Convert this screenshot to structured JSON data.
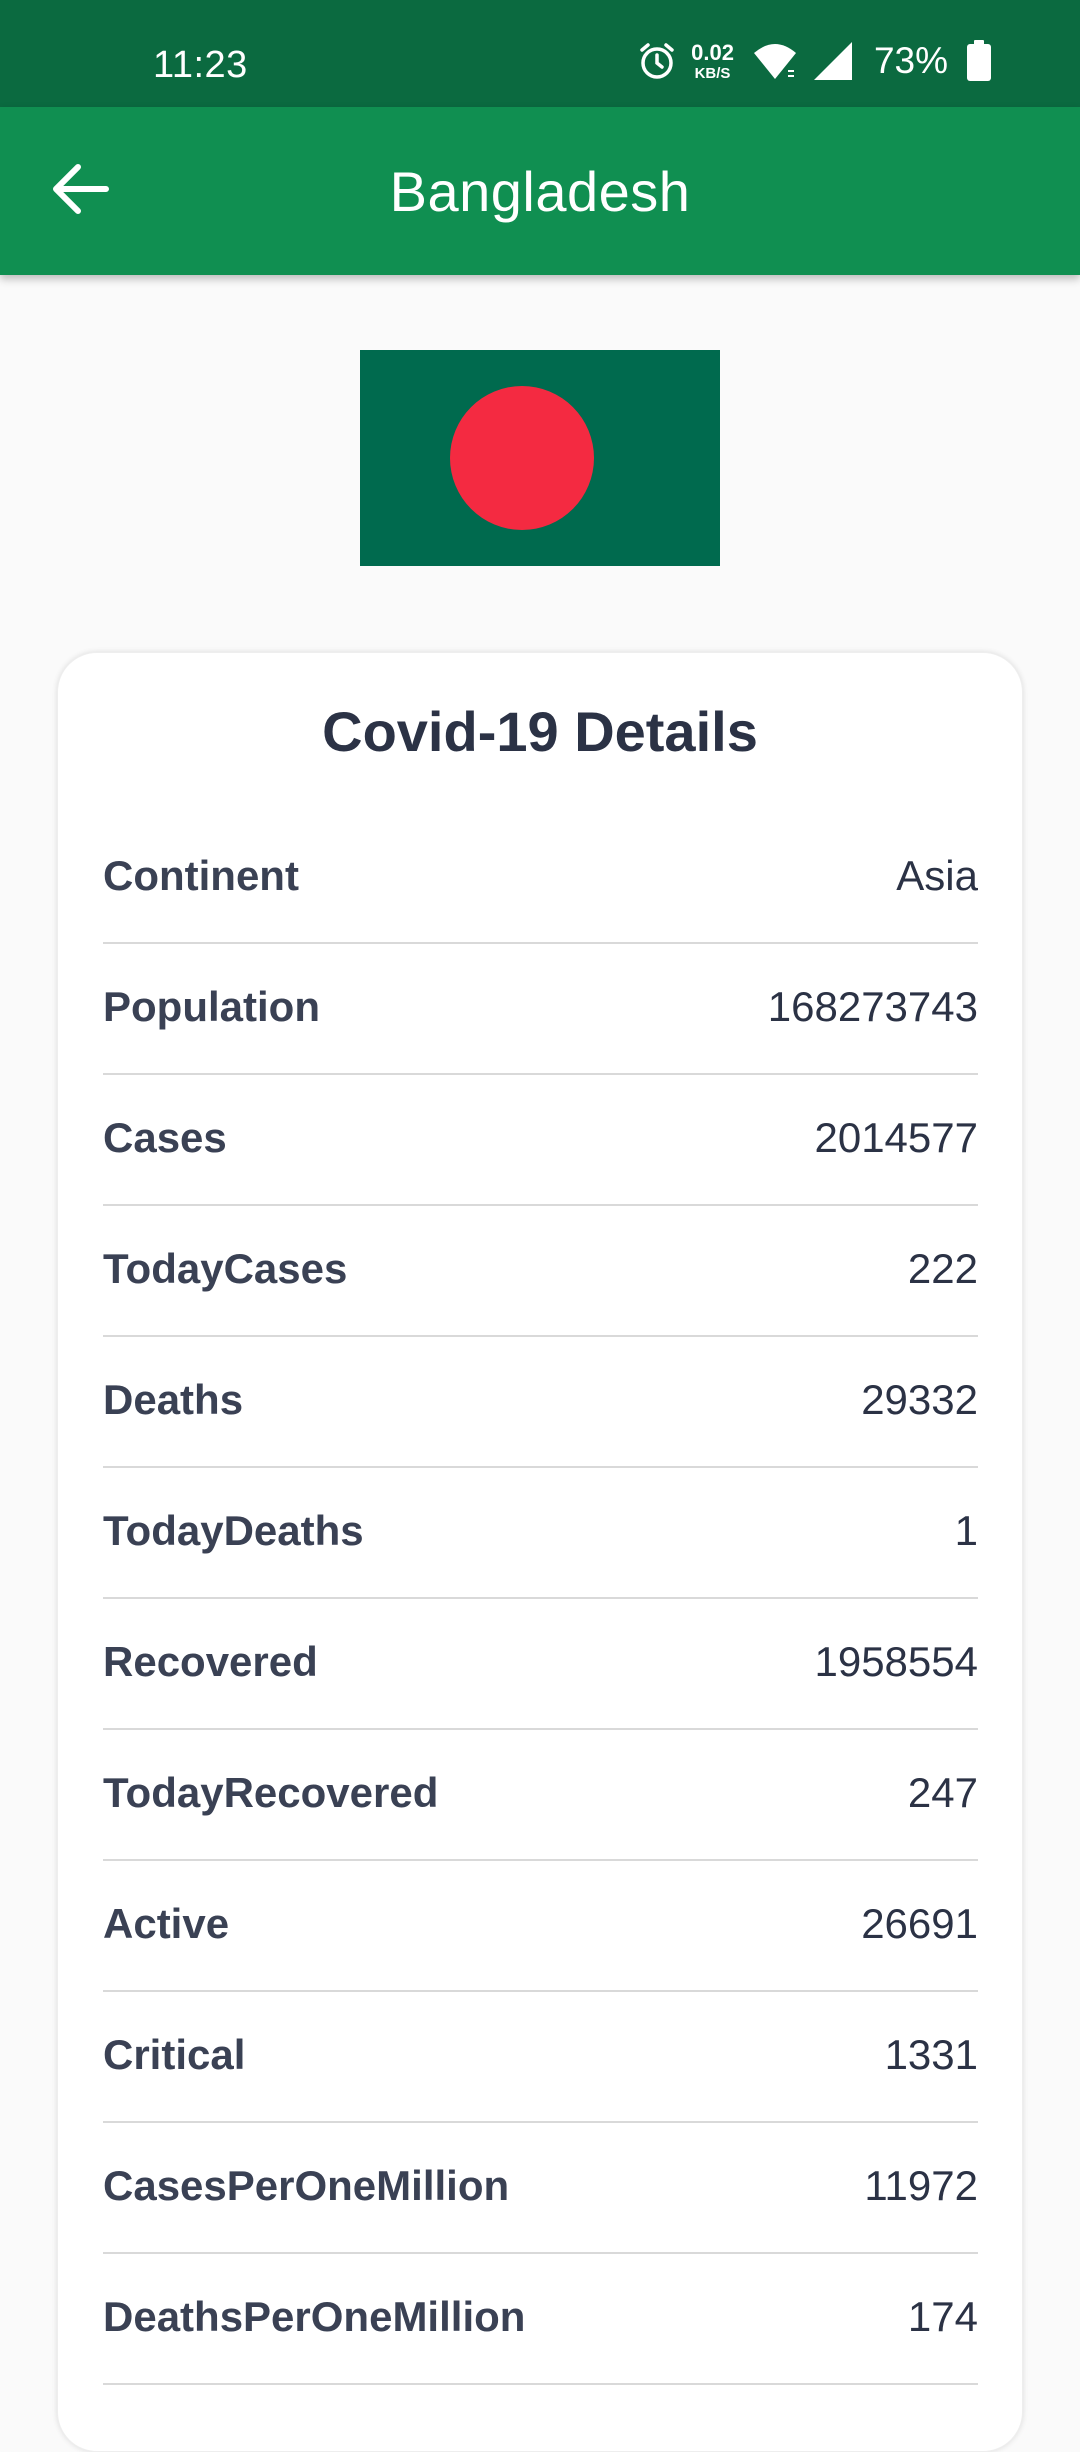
{
  "status_bar": {
    "time": "11:23",
    "net_speed_value": "0.02",
    "net_speed_unit": "KB/S",
    "battery_percent": "73%",
    "icons": [
      "alarm-icon",
      "wifi-icon",
      "cellular-signal-icon",
      "battery-icon"
    ]
  },
  "app_bar": {
    "title": "Bangladesh",
    "back_icon": "arrow-left-icon",
    "background_color": "#108f51"
  },
  "flag": {
    "country": "Bangladesh",
    "field_color": "#006a4e",
    "disc_color": "#f42a41"
  },
  "details": {
    "title": "Covid-19 Details",
    "rows": [
      {
        "label": "Continent",
        "value": "Asia"
      },
      {
        "label": "Population",
        "value": "168273743"
      },
      {
        "label": "Cases",
        "value": "2014577"
      },
      {
        "label": "TodayCases",
        "value": "222"
      },
      {
        "label": "Deaths",
        "value": "29332"
      },
      {
        "label": "TodayDeaths",
        "value": "1"
      },
      {
        "label": "Recovered",
        "value": "1958554"
      },
      {
        "label": "TodayRecovered",
        "value": "247"
      },
      {
        "label": "Active",
        "value": "26691"
      },
      {
        "label": "Critical",
        "value": "1331"
      },
      {
        "label": "CasesPerOneMillion",
        "value": "11972"
      },
      {
        "label": "DeathsPerOneMillion",
        "value": "174"
      }
    ]
  }
}
